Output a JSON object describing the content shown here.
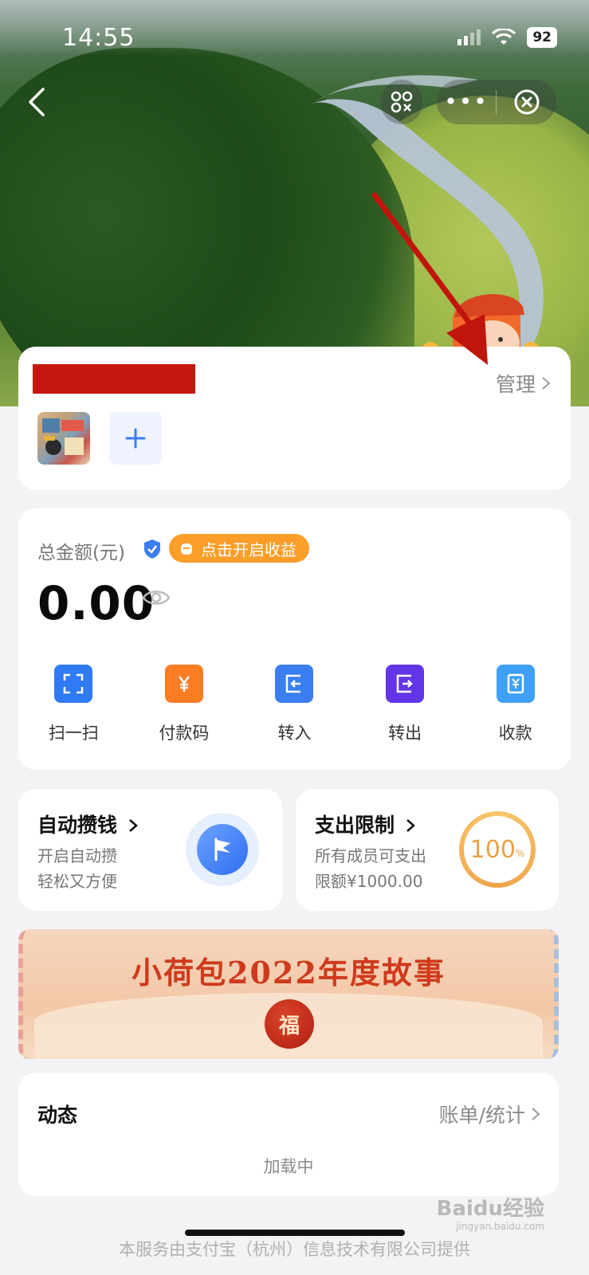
{
  "status_bar": {
    "time": "14:55",
    "battery": "92"
  },
  "nav": {
    "back_icon": "back-icon",
    "more": "•••"
  },
  "members_card": {
    "manage_label": "管理"
  },
  "balance_card": {
    "total_label": "总金额(元)",
    "earn_button": "点击开启收益",
    "amount": "0.00",
    "actions": [
      {
        "label": "扫一扫",
        "icon": "scan-icon",
        "color": "#2f7bf5"
      },
      {
        "label": "付款码",
        "icon": "yen-icon",
        "color": "#fb7d23"
      },
      {
        "label": "转入",
        "icon": "transfer-in-icon",
        "color": "#3a7ef2"
      },
      {
        "label": "转出",
        "icon": "transfer-out-icon",
        "color": "#6235e8"
      },
      {
        "label": "收款",
        "icon": "receive-icon",
        "color": "#3fa0f7"
      }
    ]
  },
  "auto_save": {
    "title": "自动攒钱",
    "line1": "开启自动攒",
    "line2": "轻松又方便"
  },
  "spend_limit": {
    "title": "支出限制",
    "line1": "所有成员可支出",
    "line2": "限额¥1000.00",
    "percent": "100",
    "percent_unit": "%"
  },
  "banner": {
    "title": "小荷包2022年度故事",
    "seal_char": "福"
  },
  "activity": {
    "title": "动态",
    "bills_link": "账单/统计",
    "loading": "加载中"
  },
  "footer": {
    "text": "本服务由支付宝（杭州）信息技术有限公司提供"
  },
  "watermark": {
    "brand": "Baidu经验",
    "url": "jingyan.baidu.com"
  }
}
